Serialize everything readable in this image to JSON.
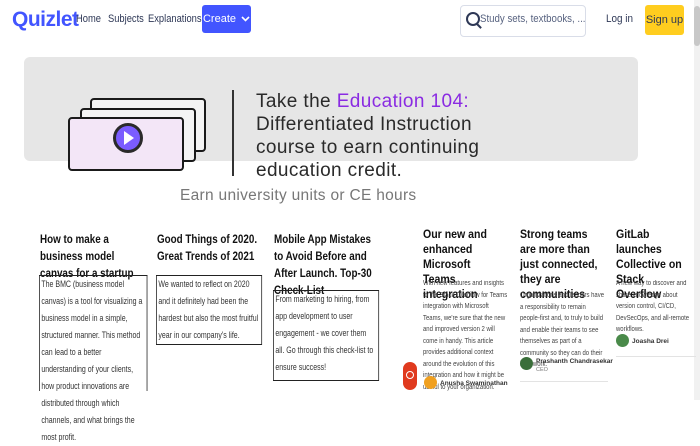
{
  "header": {
    "logo": "Quizlet",
    "nav": [
      "Home",
      "Subjects",
      "Explanations"
    ],
    "create_label": "Create",
    "search_placeholder": "Study sets, textbooks, ...",
    "login_label": "Log in",
    "signup_label": "Sign up"
  },
  "banner": {
    "line1_pre": "Take the ",
    "line1_hl": "Education 104:",
    "line2": "Differentiated Instruction",
    "line3": "course to earn continuing",
    "line4": "education credit.",
    "subtitle": "Earn university units or CE hours"
  },
  "articles": [
    {
      "title": "How to make a business model canvas for a startup",
      "body": "The BMC (business model canvas) is a tool for visualizing a business model in a simple, structured manner. This method can lead to a better understanding of your clients, how product innovations are distributed through which channels, and what brings the most profit."
    },
    {
      "title": "Good Things of 2020. Great Trends of 2021",
      "body": "We wanted to reflect on 2020 and it definitely had been the hardest but also the most fruitful year in our company's life."
    },
    {
      "title": "Mobile App Mistakes to Avoid Before and After Launch. Top-30 Check-List",
      "body": "From marketing to hiring, from app development to user engagement - we cover them all. Go through this check-list to ensure success!"
    }
  ],
  "news": [
    {
      "title": "Our new and enhanced Microsoft Teams integration",
      "body": "With new features and insights to the Stack Overflow for Teams integration with Microsoft Teams, we're sure that the new and improved version 2 will come in handy. This article provides additional context around the evolution of this integration and how it might be useful to your organization.",
      "author": "Anusha Swaminathan",
      "author_color": "#f0a020"
    },
    {
      "title": "Strong teams are more than just connected, they are communities",
      "body": "Organizations and leaders have a responsibility to remain people-first and, to truly to build and enable their teams to see themselves as part of a community so they can do their best work.",
      "author": "Prashanth Chandrasekar",
      "author_sub": "CEO",
      "author_color": "#3a6e3a"
    },
    {
      "title": "GitLab launches Collective on Stack Overflow",
      "body": "A new way to discover and share knowledge about version control, CI/CD, DevSecOps, and all-remote workflows.",
      "author": "Joasha Drei",
      "author_color": "#4a8a4a"
    }
  ],
  "colors": {
    "brand": "#4255ff",
    "signup": "#ffcd1f",
    "highlight": "#8a2be2"
  },
  "icons": [
    "search-icon",
    "chevron-down-icon",
    "play-icon",
    "feedback-icon"
  ]
}
